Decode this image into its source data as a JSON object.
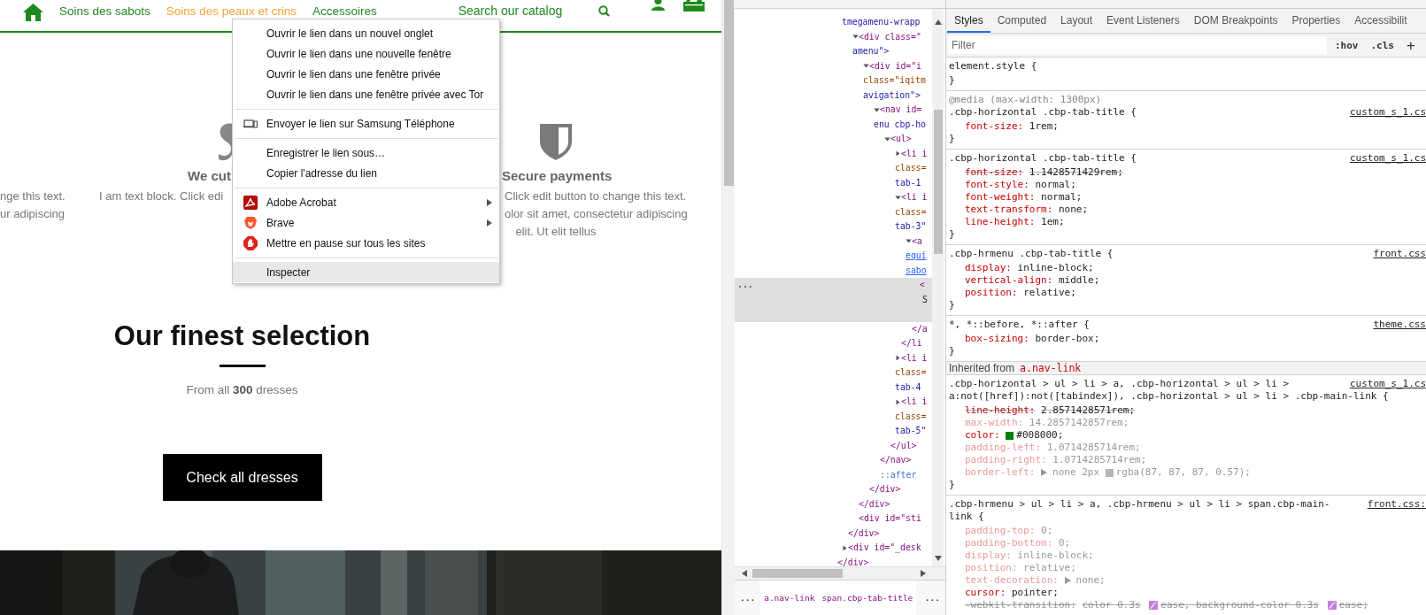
{
  "nav": {
    "items": [
      {
        "label": "Soins des sabots",
        "selected": false
      },
      {
        "label": "Soins des peaux et crins",
        "selected": true
      },
      {
        "label": "Accessoires",
        "selected": false
      }
    ],
    "search": {
      "placeholder": "Search our catalog"
    }
  },
  "features": [
    {
      "lines": [
        "nge this text.",
        "ur adipiscing"
      ]
    },
    {
      "title": "We cut",
      "lines": [
        "I am text block. Click edi"
      ]
    },
    {
      "title": "Secure payments",
      "lines": [
        "Click edit button to change this text.",
        "olor sit amet, consectetur adipiscing",
        "elit. Ut elit tellus"
      ]
    }
  ],
  "selection": {
    "title": "Our finest selection",
    "subtitle": "From all **300** dresses",
    "button": "Check all dresses"
  },
  "context_menu": {
    "sections": [
      {
        "items": [
          {
            "label": "Ouvrir le lien dans un nouvel onglet",
            "kind": "plain",
            "submenu": false,
            "selected": false
          },
          {
            "label": "Ouvrir le lien dans une nouvelle fenêtre",
            "kind": "plain",
            "submenu": false,
            "selected": false
          },
          {
            "label": "Ouvrir le lien dans une fenêtre privée",
            "kind": "plain",
            "submenu": false,
            "selected": false
          },
          {
            "label": "Ouvrir le lien dans une fenêtre privée avec Tor",
            "kind": "plain",
            "submenu": false,
            "selected": false
          }
        ]
      },
      {
        "items": [
          {
            "label": "Envoyer le lien sur Samsung Téléphone",
            "kind": "device",
            "submenu": false,
            "selected": false
          }
        ]
      },
      {
        "items": [
          {
            "label": "Enregistrer le lien sous…",
            "kind": "plain",
            "submenu": false,
            "selected": false
          },
          {
            "label": "Copier l'adresse du lien",
            "kind": "plain",
            "submenu": false,
            "selected": false
          }
        ]
      },
      {
        "items": [
          {
            "label": "Adobe Acrobat",
            "kind": "acrobat",
            "submenu": true,
            "selected": false
          },
          {
            "label": "Brave",
            "kind": "brave",
            "submenu": true,
            "selected": false
          },
          {
            "label": "Mettre en pause sur tous les sites",
            "kind": "stop",
            "submenu": false,
            "selected": false
          }
        ]
      },
      {
        "items": [
          {
            "label": "Inspecter",
            "kind": "plain",
            "submenu": false,
            "selected": true
          }
        ]
      }
    ]
  },
  "elements_panel": {
    "tree": {
      "close": "</div>",
      "children": [
        {
          "continued": true,
          "selected": false,
          "lines": [
            {
              "text": "tmegamenu-wrapp",
              "kind": "value"
            }
          ],
          "close": "</div>",
          "children": [
            {
              "expanded": true,
              "selected": false,
              "lines": [
                {
                  "text": "<div class=\"",
                  "kind": "tag"
                },
                {
                  "text": "amenu\">",
                  "kind": "value"
                }
              ],
              "close": "</div>",
              "children": [
                {
                  "expanded": true,
                  "selected": false,
                  "lines": [
                    {
                      "text": "<div id=\"i",
                      "kind": "tag"
                    },
                    {
                      "text": "class=\"iqitm",
                      "kind": "attr"
                    },
                    {
                      "text": "avigation\">",
                      "kind": "value"
                    }
                  ],
                  "close": "</div>",
                  "children": [
                    {
                      "expanded": true,
                      "selected": false,
                      "lines": [
                        {
                          "text": "<nav id=",
                          "kind": "tag"
                        },
                        {
                          "text": "enu cbp-ho",
                          "kind": "value"
                        }
                      ],
                      "close": "</nav>",
                      "children": [
                        {
                          "expanded": true,
                          "selected": false,
                          "lines": [
                            {
                              "text": "<ul>",
                              "kind": "tag"
                            }
                          ],
                          "close": "</ul>",
                          "children": [
                            {
                              "expanded": false,
                              "selected": false,
                              "lines": [
                                {
                                  "text": "<li i",
                                  "kind": "tag"
                                },
                                {
                                  "text": "class=",
                                  "kind": "attr"
                                },
                                {
                                  "text": "tab-1",
                                  "kind": "value"
                                }
                              ]
                            },
                            {
                              "expanded": true,
                              "selected": false,
                              "lines": [
                                {
                                  "text": "<li i",
                                  "kind": "tag"
                                },
                                {
                                  "text": "class=",
                                  "kind": "attr"
                                },
                                {
                                  "text": "tab-3\"",
                                  "kind": "value"
                                }
                              ],
                              "close": "</li",
                              "children": [
                                {
                                  "expanded": true,
                                  "selected": false,
                                  "lines": [
                                    {
                                      "text": "<a",
                                      "kind": "tag"
                                    },
                                    {
                                      "text": "equi",
                                      "kind": "link"
                                    },
                                    {
                                      "text": "sabo",
                                      "kind": "link"
                                    }
                                  ],
                                  "close": "</a",
                                  "children": [
                                    {
                                      "selected": true,
                                      "marker": "...",
                                      "lines": [
                                        {
                                          "text": "<",
                                          "kind": "tag"
                                        },
                                        {
                                          "text": "S",
                                          "kind": "text"
                                        }
                                      ]
                                    }
                                  ]
                                }
                              ]
                            },
                            {
                              "expanded": false,
                              "selected": false,
                              "lines": [
                                {
                                  "text": "<li i",
                                  "kind": "tag"
                                },
                                {
                                  "text": "class=",
                                  "kind": "attr"
                                },
                                {
                                  "text": "tab-4",
                                  "kind": "value"
                                }
                              ]
                            },
                            {
                              "expanded": false,
                              "selected": false,
                              "lines": [
                                {
                                  "text": "<li i",
                                  "kind": "tag"
                                },
                                {
                                  "text": "class=",
                                  "kind": "attr"
                                },
                                {
                                  "text": "tab-5\"",
                                  "kind": "value"
                                }
                              ]
                            }
                          ]
                        }
                      ]
                    },
                    {
                      "selected": false,
                      "lines": [
                        {
                          "text": "::after",
                          "kind": "pseudo"
                        }
                      ]
                    }
                  ]
                }
              ]
            },
            {
              "selected": false,
              "lines": [
                {
                  "text": "<div id=\"sti",
                  "kind": "tag"
                }
              ]
            }
          ]
        },
        {
          "expanded": false,
          "selected": false,
          "lines": [
            {
              "text": "<div id=\"_desk",
              "kind": "tag"
            }
          ]
        }
      ]
    },
    "breadcrumbs": [
      {
        "label": "...",
        "kind": "more"
      },
      {
        "label": "a.nav-link",
        "kind": "crumb"
      },
      {
        "label": "span.cbp-tab-title",
        "kind": "crumb"
      },
      {
        "label": "...",
        "kind": "more"
      }
    ]
  },
  "styles_panel": {
    "tabs": [
      {
        "label": "Styles",
        "selected": true
      },
      {
        "label": "Computed",
        "selected": false
      },
      {
        "label": "Layout",
        "selected": false
      },
      {
        "label": "Event Listeners",
        "selected": false
      },
      {
        "label": "DOM Breakpoints",
        "selected": false
      },
      {
        "label": "Properties",
        "selected": false
      },
      {
        "label": "Accessibilit",
        "selected": false
      }
    ],
    "filter": {
      "placeholder": "Filter"
    },
    "buttons": [
      ":hov",
      ".cls",
      "+"
    ],
    "rules": [
      {
        "kind": "rule",
        "selector": [
          "element.style {"
        ],
        "close": "}"
      },
      {
        "kind": "rule",
        "media": "@media (max-width: 1300px)",
        "selector": [
          ".cbp-horizontal .cbp-tab-title {"
        ],
        "source": "custom_s_1.cs",
        "close": "}",
        "declarations": [
          {
            "property": "font-size:",
            "value": "1rem;",
            "struck": false,
            "inactive": false
          }
        ]
      },
      {
        "kind": "rule",
        "selector": [
          ".cbp-horizontal .cbp-tab-title {"
        ],
        "source": "custom_s_1.cs",
        "close": "}",
        "declarations": [
          {
            "property": "font-size:",
            "value": "1.1428571429rem;",
            "struck": true,
            "inactive": false
          },
          {
            "property": "font-style:",
            "value": "normal;",
            "struck": false,
            "inactive": false
          },
          {
            "property": "font-weight:",
            "value": "normal;",
            "struck": false,
            "inactive": false
          },
          {
            "property": "text-transform:",
            "value": "none;",
            "struck": false,
            "inactive": false
          },
          {
            "property": "line-height:",
            "value": "1em;",
            "struck": false,
            "inactive": false
          }
        ]
      },
      {
        "kind": "rule",
        "selector": [
          ".cbp-hrmenu .cbp-tab-title {"
        ],
        "source": "front.css",
        "close": "}",
        "declarations": [
          {
            "property": "display:",
            "value": "inline-block;",
            "struck": false,
            "inactive": false
          },
          {
            "property": "vertical-align:",
            "value": "middle;",
            "struck": false,
            "inactive": false
          },
          {
            "property": "position:",
            "value": "relative;",
            "struck": false,
            "inactive": false
          }
        ]
      },
      {
        "kind": "rule",
        "selector": [
          "*, *::before, *::after {"
        ],
        "source": "theme.css",
        "close": "}",
        "declarations": [
          {
            "property": "box-sizing:",
            "value": "border-box;",
            "struck": false,
            "inactive": false
          }
        ]
      },
      {
        "kind": "inherited",
        "label": "Inherited from",
        "selector": "a.nav-link"
      },
      {
        "kind": "rule",
        "selector": [
          ".cbp-horizontal > ul > li > a, .cbp-horizontal > ul > li >",
          "a:not([href]):not([tabindex]), .cbp-horizontal > ul > li > .cbp-main-link {"
        ],
        "source": "custom_s_1.cs",
        "close": "}",
        "declarations": [
          {
            "property": "line-height:",
            "value": "2.8571428571rem;",
            "struck": true,
            "inactive": false
          },
          {
            "property": "max-width:",
            "value": "14.2857142857rem;",
            "struck": false,
            "inactive": true
          },
          {
            "property": "color:",
            "parts": [
              {
                "kind": "swatch",
                "color": "#008000"
              },
              {
                "kind": "text",
                "text": "#008000;"
              }
            ],
            "struck": false,
            "inactive": false
          },
          {
            "property": "padding-left:",
            "value": "1.0714285714rem;",
            "struck": false,
            "inactive": true
          },
          {
            "property": "padding-right:",
            "value": "1.0714285714rem;",
            "struck": false,
            "inactive": true
          },
          {
            "property": "border-left:",
            "parts": [
              {
                "kind": "expand"
              },
              {
                "kind": "text",
                "text": "none 2px"
              },
              {
                "kind": "swatch",
                "color": "#b5b5b5"
              },
              {
                "kind": "text",
                "text": "rgba(87, 87, 87, 0.57);"
              }
            ],
            "struck": false,
            "inactive": true
          }
        ]
      },
      {
        "kind": "rule",
        "selector": [
          ".cbp-hrmenu > ul > li > a, .cbp-hrmenu > ul > li > span.cbp-main-",
          "link {"
        ],
        "source": "front.css:",
        "declarations": [
          {
            "property": "padding-top:",
            "value": "0;",
            "struck": false,
            "inactive": true
          },
          {
            "property": "padding-bottom:",
            "value": "0;",
            "struck": false,
            "inactive": true
          },
          {
            "property": "display:",
            "value": "inline-block;",
            "struck": false,
            "inactive": true
          },
          {
            "property": "position:",
            "value": "relative;",
            "struck": false,
            "inactive": true
          },
          {
            "property": "text-decoration:",
            "parts": [
              {
                "kind": "expand"
              },
              {
                "kind": "text",
                "text": "none;"
              }
            ],
            "struck": false,
            "inactive": true
          },
          {
            "property": "cursor:",
            "value": "pointer;",
            "struck": false,
            "inactive": false
          },
          {
            "property": "-webkit-transition:",
            "parts": [
              {
                "kind": "text",
                "text": "color 0.3s"
              },
              {
                "kind": "easing"
              },
              {
                "kind": "text",
                "text": "ease, background-color 0.3s"
              },
              {
                "kind": "easing"
              },
              {
                "kind": "text",
                "text": "ease;"
              }
            ],
            "struck": true,
            "inactive": true
          }
        ]
      }
    ]
  }
}
